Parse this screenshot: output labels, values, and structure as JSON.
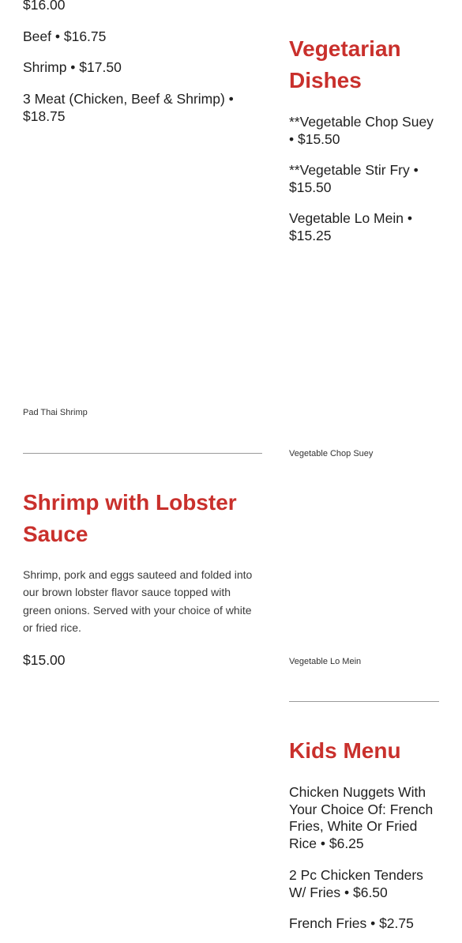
{
  "left_column": {
    "partial_price": "$16.00",
    "combo_items": [
      "Beef • $16.75",
      "Shrimp • $17.50",
      "3 Meat (Chicken, Beef & Shrimp) • $18.75"
    ],
    "image_caption": "Pad Thai Shrimp",
    "lobster_section": {
      "title": "Shrimp with Lobster Sauce",
      "description": "Shrimp, pork and eggs sauteed and folded into our brown lobster flavor sauce topped with green onions. Served with your choice of white or fried rice.",
      "price": "$15.00"
    }
  },
  "right_column": {
    "vegetarian_section": {
      "title": "Vegetarian Dishes",
      "items": [
        "**Vegetable Chop Suey • $15.50",
        "**Vegetable Stir Fry • $15.50",
        "Vegetable Lo Mein • $15.25"
      ],
      "captions": [
        "Vegetable Chop Suey",
        "Vegetable Lo Mein"
      ]
    },
    "kids_section": {
      "title": "Kids Menu",
      "items": [
        "Chicken Nuggets With Your Choice Of: French Fries, White Or Fried Rice • $6.25",
        "2 Pc Chicken Tenders W/ Fries • $6.50",
        "French Fries • $2.75"
      ]
    }
  },
  "colors": {
    "heading_red": "#c9302c",
    "text_dark": "#1f1f1f",
    "divider_gray": "#9a9a9a"
  }
}
